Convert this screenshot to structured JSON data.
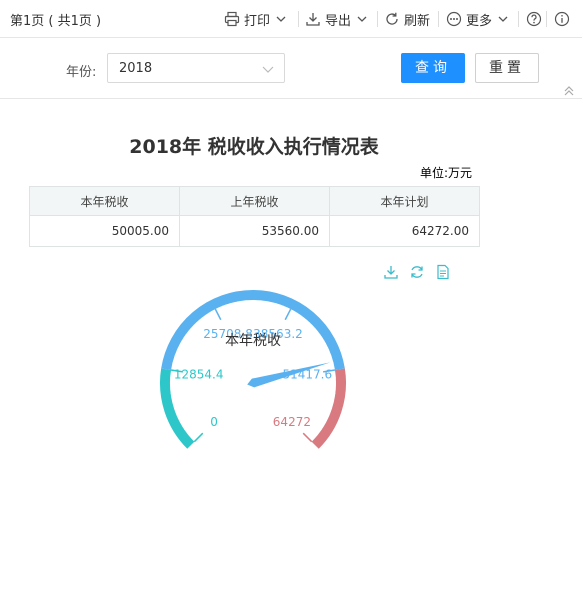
{
  "toolbar": {
    "page_info": "第1页 ( 共1页 )",
    "print_label": "打印",
    "export_label": "导出",
    "refresh_label": "刷新",
    "more_label": "更多"
  },
  "filter": {
    "year_label": "年份:",
    "year_value": "2018",
    "query_label": "查询",
    "reset_label": "重置"
  },
  "report": {
    "title": "2018年 税收收入执行情况表",
    "unit": "单位:万元",
    "columns": [
      "本年税收",
      "上年税收",
      "本年计划"
    ],
    "row": [
      "50005.00",
      "53560.00",
      "64272.00"
    ]
  },
  "chart_data": {
    "type": "gauge",
    "title": "本年税收",
    "min": 0,
    "max": 64272,
    "value": 50005,
    "tick_labels": [
      "0",
      "12854.4",
      "25708.8",
      "38563.2",
      "51417.6",
      "64272"
    ],
    "bands": [
      {
        "from": 0,
        "to": 0.2,
        "color": "#2ec7c9"
      },
      {
        "from": 0.2,
        "to": 0.8,
        "color": "#5ab1ef"
      },
      {
        "from": 0.8,
        "to": 1.0,
        "color": "#d87a80"
      }
    ]
  }
}
